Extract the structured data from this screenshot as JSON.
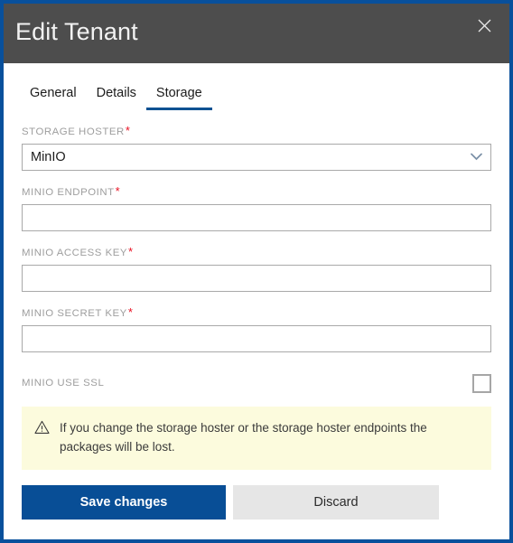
{
  "window": {
    "title": "Edit Tenant",
    "close_icon": "close-icon",
    "border_color": "#08509c",
    "titlebar_color": "#4d4d4d"
  },
  "tabs": [
    {
      "label": "General",
      "active": false
    },
    {
      "label": "Details",
      "active": false
    },
    {
      "label": "Storage",
      "active": true
    }
  ],
  "form": {
    "storage_hoster": {
      "label": "STORAGE HOSTER",
      "required_marker": "*",
      "value": "MinIO",
      "chevron_icon": "chevron-down-icon"
    },
    "minio_endpoint": {
      "label": "MINIO ENDPOINT",
      "required_marker": "*",
      "value": "",
      "placeholder": ""
    },
    "minio_access_key": {
      "label": "MINIO ACCESS KEY",
      "required_marker": "*",
      "value": "",
      "placeholder": ""
    },
    "minio_secret_key": {
      "label": "MINIO SECRET KEY",
      "required_marker": "*",
      "value": "",
      "placeholder": ""
    },
    "minio_use_ssl": {
      "label": "MINIO USE SSL",
      "checked": false
    }
  },
  "warning": {
    "icon": "warning-triangle-icon",
    "text": "If you change the storage hoster or the storage hoster endpoints the packages will be lost.",
    "background": "#fcfbdd"
  },
  "actions": {
    "save_label": "Save changes",
    "discard_label": "Discard",
    "save_color": "#084e96",
    "discard_color": "#e6e6e6"
  },
  "colors": {
    "accent": "#0c5192",
    "required": "#e81123",
    "label": "#9e9e9e"
  }
}
